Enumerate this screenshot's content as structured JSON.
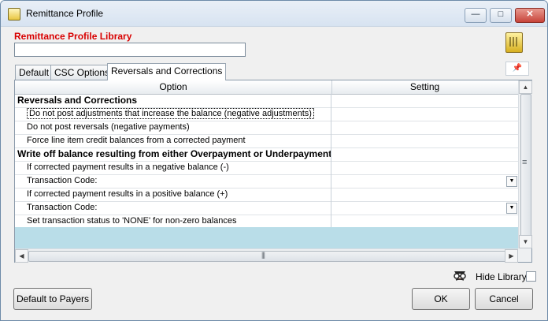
{
  "window": {
    "title": "Remittance Profile",
    "minimize_glyph": "—",
    "maximize_glyph": "□",
    "close_glyph": "✕"
  },
  "library": {
    "label": "Remittance Profile Library",
    "value": ""
  },
  "tabs": [
    {
      "label": "Default",
      "active": false
    },
    {
      "label": "CSC Options",
      "active": false
    },
    {
      "label": "Reversals and Corrections",
      "active": true
    }
  ],
  "grid": {
    "columns": [
      "Option",
      "Setting"
    ],
    "rows": [
      {
        "type": "category",
        "option": "Reversals and Corrections",
        "setting": ""
      },
      {
        "type": "item",
        "option": "Do not post adjustments that increase the balance (negative adjustments)",
        "setting": "",
        "selected": true
      },
      {
        "type": "item",
        "option": "Do not post reversals (negative payments)",
        "setting": ""
      },
      {
        "type": "item",
        "option": "Force line item credit balances from a corrected payment",
        "setting": ""
      },
      {
        "type": "category",
        "option": "Write off balance resulting from either Overpayment or Underpayment ..",
        "setting": ""
      },
      {
        "type": "item",
        "option": "If corrected payment results in a negative balance (-)",
        "setting": ""
      },
      {
        "type": "item",
        "option": "Transaction Code:",
        "setting": "",
        "dropdown": true
      },
      {
        "type": "item",
        "option": "If corrected payment results in a positive balance (+)",
        "setting": ""
      },
      {
        "type": "item",
        "option": "Transaction Code:",
        "setting": "",
        "dropdown": true
      },
      {
        "type": "item",
        "option": "Set transaction status to 'NONE' for non-zero balances",
        "setting": ""
      }
    ],
    "description_text": ""
  },
  "pin_icon": "pin-icon",
  "hide_library": {
    "label": "Hide Library",
    "checked": false
  },
  "buttons": {
    "default_to_payers": "Default to Payers",
    "ok": "OK",
    "cancel": "Cancel"
  },
  "scroll_glyphs": {
    "up": "▲",
    "down": "▼",
    "left": "◀",
    "right": "▶",
    "dropdown": "▼"
  }
}
